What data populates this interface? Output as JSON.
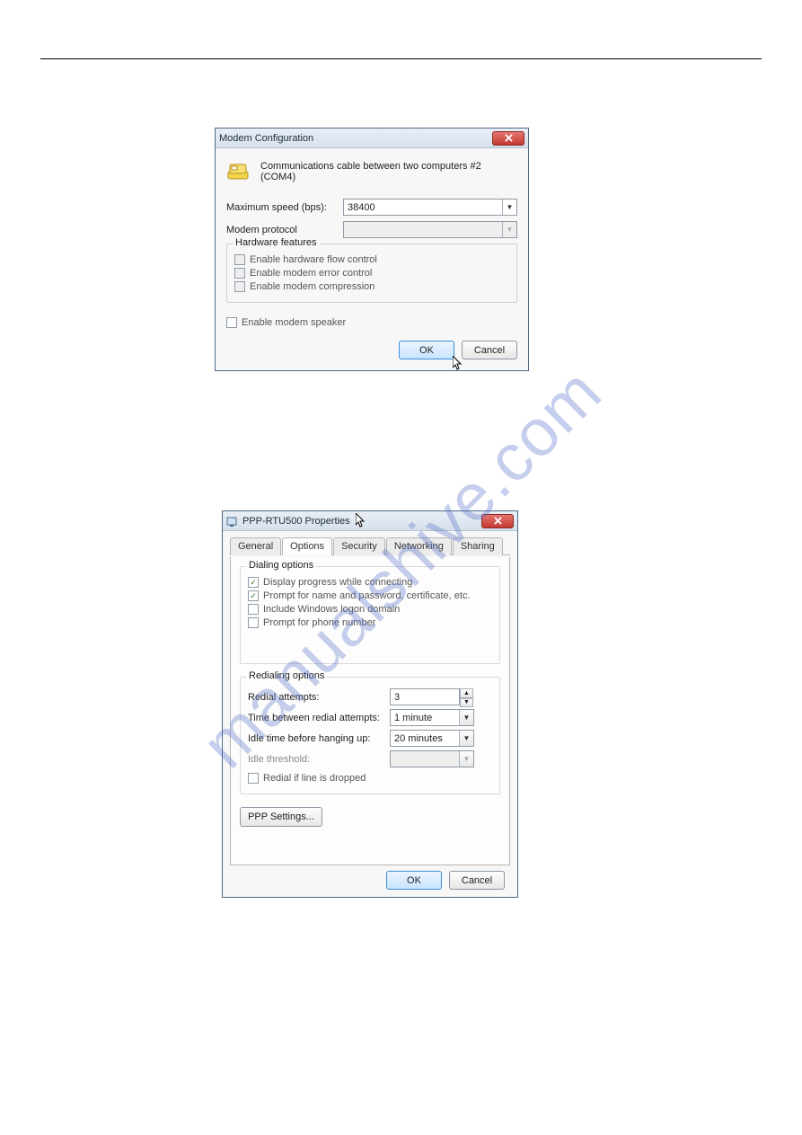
{
  "watermark": "manualshive.com",
  "dialog1": {
    "title": "Modem Configuration",
    "desc": "Communications cable between two computers #2 (COM4)",
    "max_speed_label": "Maximum speed (bps):",
    "max_speed_value": "38400",
    "protocol_label": "Modem protocol",
    "protocol_value": "",
    "hw_group": "Hardware features",
    "chk_flow": "Enable hardware flow control",
    "chk_err": "Enable modem error control",
    "chk_comp": "Enable modem compression",
    "chk_speaker": "Enable modem speaker",
    "ok": "OK",
    "cancel": "Cancel"
  },
  "dialog2": {
    "title": "PPP-RTU500 Properties",
    "tabs": {
      "general": "General",
      "options": "Options",
      "security": "Security",
      "networking": "Networking",
      "sharing": "Sharing"
    },
    "dialing_group": "Dialing options",
    "chk_progress": "Display progress while connecting",
    "chk_prompt_cred": "Prompt for name and password, certificate, etc.",
    "chk_logon": "Include Windows logon domain",
    "chk_prompt_phone": "Prompt for phone number",
    "redial_group": "Redialing options",
    "redial_attempts_label": "Redial attempts:",
    "redial_attempts_value": "3",
    "time_between_label": "Time between redial attempts:",
    "time_between_value": "1 minute",
    "idle_hangup_label": "Idle time before hanging up:",
    "idle_hangup_value": "20 minutes",
    "idle_threshold_label": "Idle threshold:",
    "chk_redial_drop": "Redial if line is dropped",
    "ppp_settings": "PPP Settings...",
    "ok": "OK",
    "cancel": "Cancel"
  }
}
